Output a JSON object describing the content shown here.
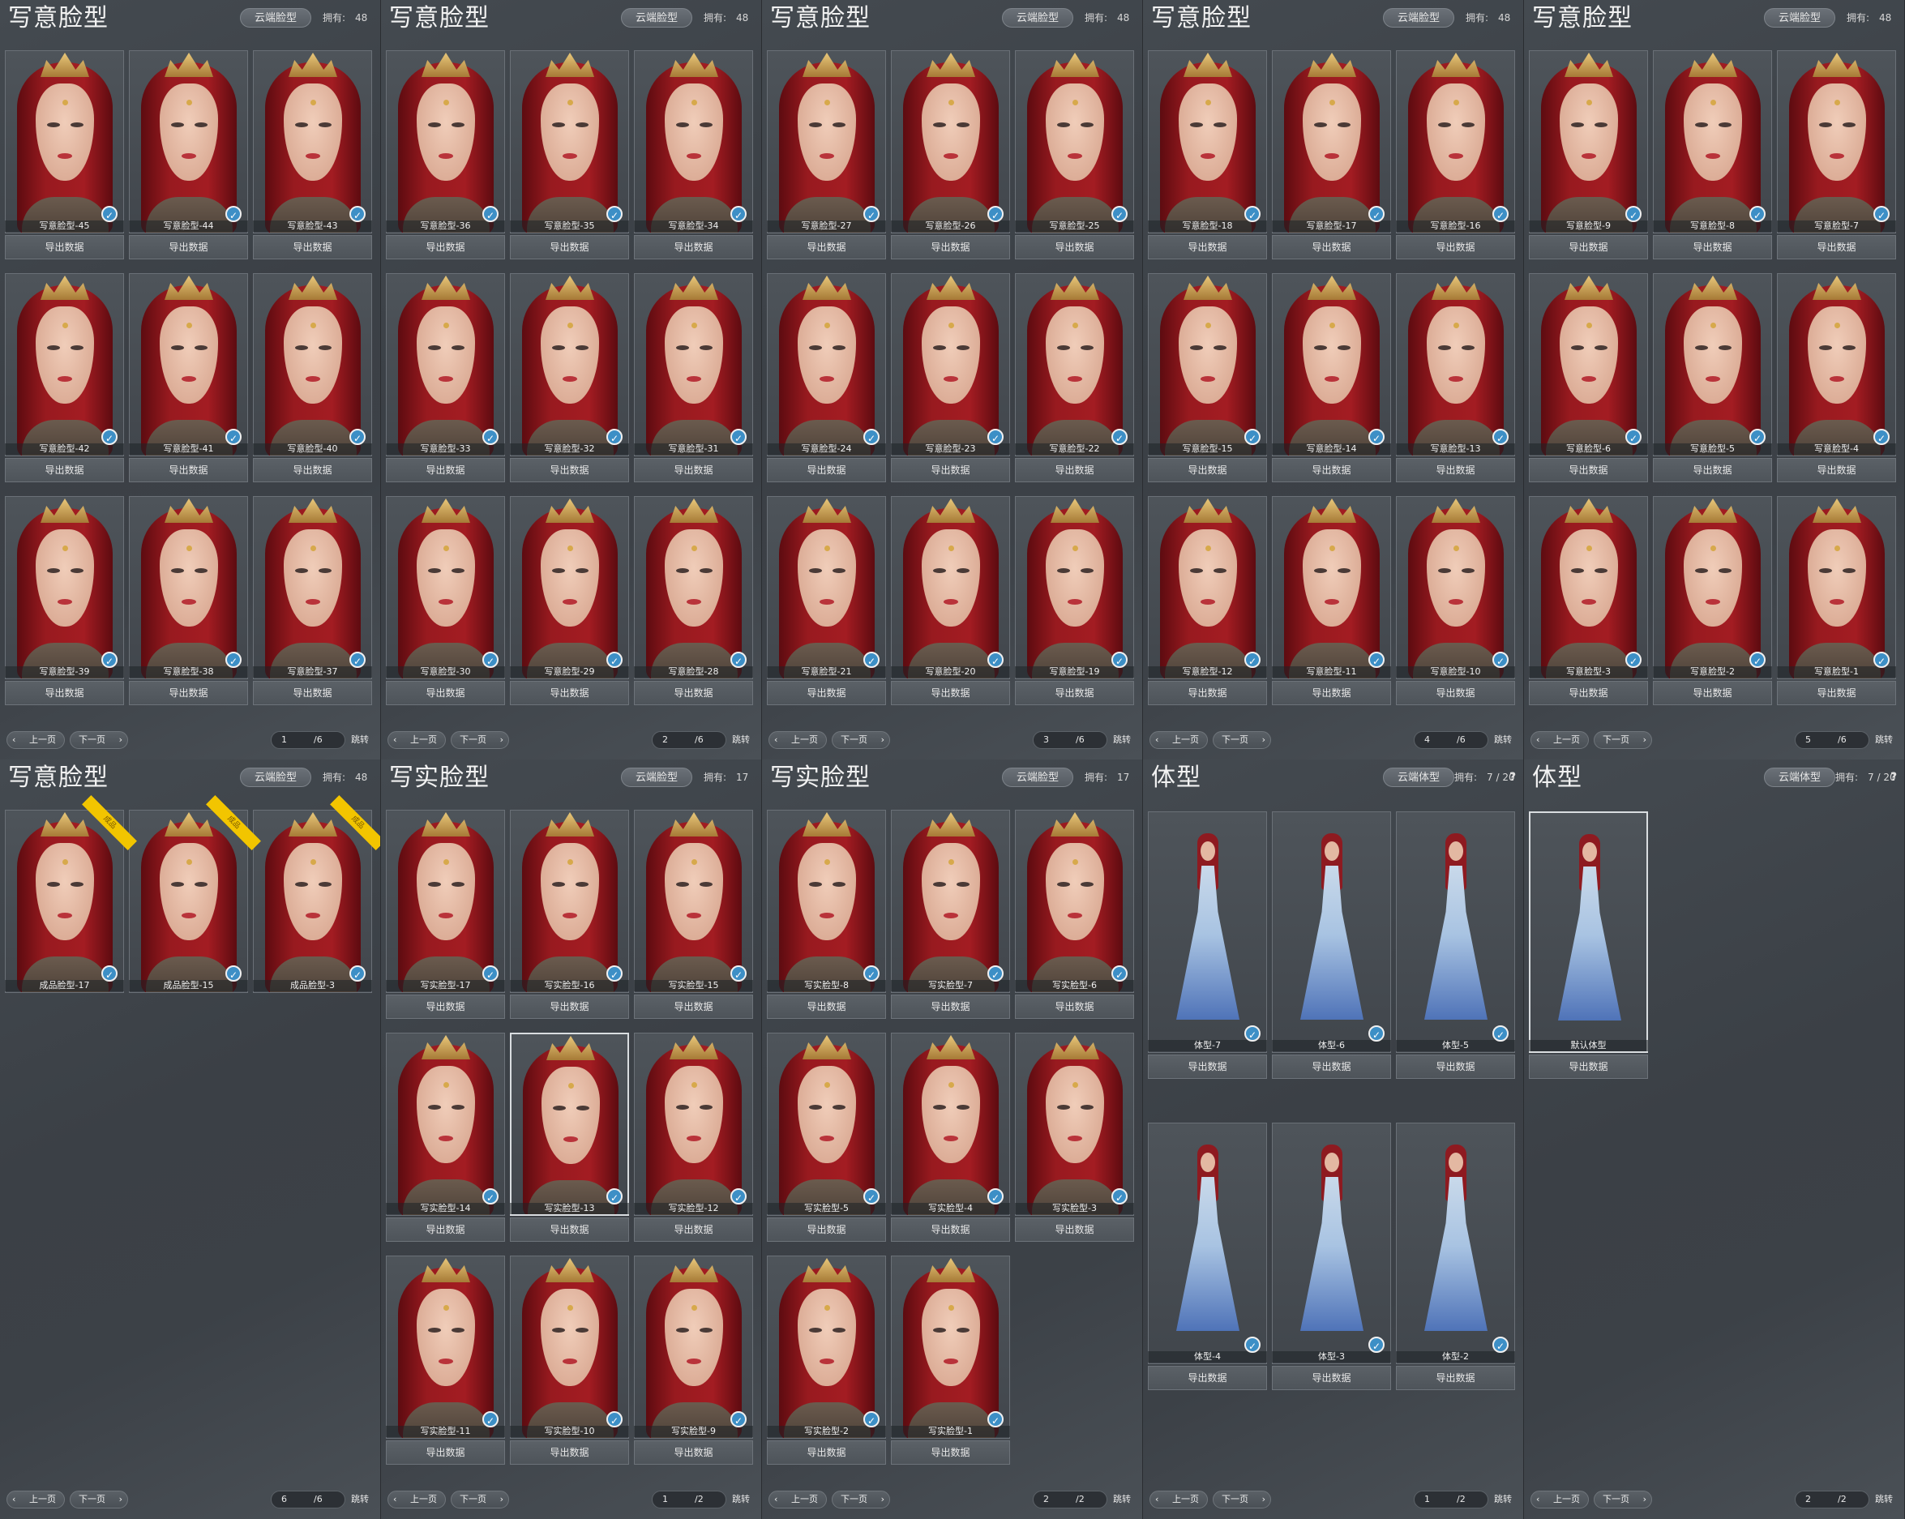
{
  "panels": [
    {
      "title": "写意脸型",
      "cloud": "云端脸型",
      "own_label": "拥有:",
      "own_value": "48",
      "has_help": false,
      "cards": [
        {
          "label": "写意脸型-45",
          "kind": "face",
          "btn": "导出数据"
        },
        {
          "label": "写意脸型-44",
          "kind": "face",
          "btn": "导出数据"
        },
        {
          "label": "写意脸型-43",
          "kind": "face",
          "btn": "导出数据"
        },
        {
          "label": "写意脸型-42",
          "kind": "face",
          "btn": "导出数据"
        },
        {
          "label": "写意脸型-41",
          "kind": "face",
          "btn": "导出数据"
        },
        {
          "label": "写意脸型-40",
          "kind": "face",
          "btn": "导出数据"
        },
        {
          "label": "写意脸型-39",
          "kind": "face",
          "btn": "导出数据"
        },
        {
          "label": "写意脸型-38",
          "kind": "face",
          "btn": "导出数据"
        },
        {
          "label": "写意脸型-37",
          "kind": "face",
          "btn": "导出数据"
        }
      ],
      "pager": {
        "prev": "上一页",
        "next": "下一页",
        "current": "1",
        "total": "/6",
        "go": "跳转"
      }
    },
    {
      "title": "写意脸型",
      "cloud": "云端脸型",
      "own_label": "拥有:",
      "own_value": "48",
      "has_help": false,
      "cards": [
        {
          "label": "写意脸型-36",
          "kind": "face",
          "btn": "导出数据"
        },
        {
          "label": "写意脸型-35",
          "kind": "face",
          "btn": "导出数据"
        },
        {
          "label": "写意脸型-34",
          "kind": "face",
          "btn": "导出数据"
        },
        {
          "label": "写意脸型-33",
          "kind": "face",
          "btn": "导出数据"
        },
        {
          "label": "写意脸型-32",
          "kind": "face",
          "btn": "导出数据"
        },
        {
          "label": "写意脸型-31",
          "kind": "face",
          "btn": "导出数据"
        },
        {
          "label": "写意脸型-30",
          "kind": "face",
          "btn": "导出数据"
        },
        {
          "label": "写意脸型-29",
          "kind": "face",
          "btn": "导出数据"
        },
        {
          "label": "写意脸型-28",
          "kind": "face",
          "btn": "导出数据"
        }
      ],
      "pager": {
        "prev": "上一页",
        "next": "下一页",
        "current": "2",
        "total": "/6",
        "go": "跳转"
      }
    },
    {
      "title": "写意脸型",
      "cloud": "云端脸型",
      "own_label": "拥有:",
      "own_value": "48",
      "has_help": false,
      "cards": [
        {
          "label": "写意脸型-27",
          "kind": "face",
          "btn": "导出数据"
        },
        {
          "label": "写意脸型-26",
          "kind": "face",
          "btn": "导出数据"
        },
        {
          "label": "写意脸型-25",
          "kind": "face",
          "btn": "导出数据"
        },
        {
          "label": "写意脸型-24",
          "kind": "face",
          "btn": "导出数据"
        },
        {
          "label": "写意脸型-23",
          "kind": "face",
          "btn": "导出数据"
        },
        {
          "label": "写意脸型-22",
          "kind": "face",
          "btn": "导出数据"
        },
        {
          "label": "写意脸型-21",
          "kind": "face",
          "btn": "导出数据"
        },
        {
          "label": "写意脸型-20",
          "kind": "face",
          "btn": "导出数据"
        },
        {
          "label": "写意脸型-19",
          "kind": "face",
          "btn": "导出数据"
        }
      ],
      "pager": {
        "prev": "上一页",
        "next": "下一页",
        "current": "3",
        "total": "/6",
        "go": "跳转"
      }
    },
    {
      "title": "写意脸型",
      "cloud": "云端脸型",
      "own_label": "拥有:",
      "own_value": "48",
      "has_help": false,
      "cards": [
        {
          "label": "写意脸型-18",
          "kind": "face",
          "btn": "导出数据"
        },
        {
          "label": "写意脸型-17",
          "kind": "face",
          "btn": "导出数据"
        },
        {
          "label": "写意脸型-16",
          "kind": "face",
          "btn": "导出数据"
        },
        {
          "label": "写意脸型-15",
          "kind": "face",
          "btn": "导出数据"
        },
        {
          "label": "写意脸型-14",
          "kind": "face",
          "btn": "导出数据"
        },
        {
          "label": "写意脸型-13",
          "kind": "face",
          "btn": "导出数据"
        },
        {
          "label": "写意脸型-12",
          "kind": "face",
          "btn": "导出数据"
        },
        {
          "label": "写意脸型-11",
          "kind": "face",
          "btn": "导出数据"
        },
        {
          "label": "写意脸型-10",
          "kind": "face",
          "btn": "导出数据"
        }
      ],
      "pager": {
        "prev": "上一页",
        "next": "下一页",
        "current": "4",
        "total": "/6",
        "go": "跳转"
      }
    },
    {
      "title": "写意脸型",
      "cloud": "云端脸型",
      "own_label": "拥有:",
      "own_value": "48",
      "has_help": false,
      "cards": [
        {
          "label": "写意脸型-9",
          "kind": "face",
          "btn": "导出数据"
        },
        {
          "label": "写意脸型-8",
          "kind": "face",
          "btn": "导出数据"
        },
        {
          "label": "写意脸型-7",
          "kind": "face",
          "btn": "导出数据"
        },
        {
          "label": "写意脸型-6",
          "kind": "face",
          "btn": "导出数据"
        },
        {
          "label": "写意脸型-5",
          "kind": "face",
          "btn": "导出数据"
        },
        {
          "label": "写意脸型-4",
          "kind": "face",
          "btn": "导出数据"
        },
        {
          "label": "写意脸型-3",
          "kind": "face",
          "btn": "导出数据"
        },
        {
          "label": "写意脸型-2",
          "kind": "face",
          "btn": "导出数据"
        },
        {
          "label": "写意脸型-1",
          "kind": "face",
          "btn": "导出数据"
        }
      ],
      "pager": {
        "prev": "上一页",
        "next": "下一页",
        "current": "5",
        "total": "/6",
        "go": "跳转"
      }
    },
    {
      "title": "写意脸型",
      "cloud": "云端脸型",
      "own_label": "拥有:",
      "own_value": "48",
      "has_help": false,
      "cards": [
        {
          "label": "成品脸型-17",
          "kind": "face",
          "ribbon": "成品"
        },
        {
          "label": "成品脸型-15",
          "kind": "face",
          "ribbon": "成品"
        },
        {
          "label": "成品脸型-3",
          "kind": "face",
          "ribbon": "成品"
        }
      ],
      "pager": {
        "prev": "上一页",
        "next": "下一页",
        "current": "6",
        "total": "/6",
        "go": "跳转"
      }
    },
    {
      "title": "写实脸型",
      "cloud": "云端脸型",
      "own_label": "拥有:",
      "own_value": "17",
      "has_help": false,
      "cards": [
        {
          "label": "写实脸型-17",
          "kind": "face",
          "btn": "导出数据"
        },
        {
          "label": "写实脸型-16",
          "kind": "face",
          "btn": "导出数据"
        },
        {
          "label": "写实脸型-15",
          "kind": "face",
          "btn": "导出数据"
        },
        {
          "label": "写实脸型-14",
          "kind": "face",
          "btn": "导出数据"
        },
        {
          "label": "写实脸型-13",
          "kind": "face",
          "btn": "导出数据",
          "selected": true
        },
        {
          "label": "写实脸型-12",
          "kind": "face",
          "btn": "导出数据"
        },
        {
          "label": "写实脸型-11",
          "kind": "face",
          "btn": "导出数据"
        },
        {
          "label": "写实脸型-10",
          "kind": "face",
          "btn": "导出数据"
        },
        {
          "label": "写实脸型-9",
          "kind": "face",
          "btn": "导出数据"
        }
      ],
      "pager": {
        "prev": "上一页",
        "next": "下一页",
        "current": "1",
        "total": "/2",
        "go": "跳转"
      }
    },
    {
      "title": "写实脸型",
      "cloud": "云端脸型",
      "own_label": "拥有:",
      "own_value": "17",
      "has_help": false,
      "cards": [
        {
          "label": "写实脸型-8",
          "kind": "face",
          "btn": "导出数据"
        },
        {
          "label": "写实脸型-7",
          "kind": "face",
          "btn": "导出数据"
        },
        {
          "label": "写实脸型-6",
          "kind": "face",
          "btn": "导出数据"
        },
        {
          "label": "写实脸型-5",
          "kind": "face",
          "btn": "导出数据"
        },
        {
          "label": "写实脸型-4",
          "kind": "face",
          "btn": "导出数据"
        },
        {
          "label": "写实脸型-3",
          "kind": "face",
          "btn": "导出数据"
        },
        {
          "label": "写实脸型-2",
          "kind": "face",
          "btn": "导出数据"
        },
        {
          "label": "写实脸型-1",
          "kind": "face",
          "btn": "导出数据"
        }
      ],
      "pager": {
        "prev": "上一页",
        "next": "下一页",
        "current": "2",
        "total": "/2",
        "go": "跳转"
      }
    },
    {
      "title": "体型",
      "cloud": "云端体型",
      "own_label": "拥有:",
      "own_value": "7 / 20",
      "has_help": true,
      "help": "?",
      "cards": [
        {
          "label": "体型-7",
          "kind": "body",
          "btn": "导出数据"
        },
        {
          "label": "体型-6",
          "kind": "body",
          "btn": "导出数据"
        },
        {
          "label": "体型-5",
          "kind": "body",
          "btn": "导出数据"
        },
        {
          "label": "体型-4",
          "kind": "body",
          "btn": "导出数据"
        },
        {
          "label": "体型-3",
          "kind": "body",
          "btn": "导出数据"
        },
        {
          "label": "体型-2",
          "kind": "body",
          "btn": "导出数据"
        }
      ],
      "pager": {
        "prev": "上一页",
        "next": "下一页",
        "current": "1",
        "total": "/2",
        "go": "跳转"
      }
    },
    {
      "title": "体型",
      "cloud": "云端体型",
      "own_label": "拥有:",
      "own_value": "7 / 20",
      "has_help": true,
      "help": "?",
      "cards": [
        {
          "label": "默认体型",
          "kind": "body",
          "btn": "导出数据",
          "selected": true,
          "no_badge": true
        }
      ],
      "pager": {
        "prev": "上一页",
        "next": "下一页",
        "current": "2",
        "total": "/2",
        "go": "跳转"
      }
    }
  ],
  "icons": {
    "badge": "brush-check-icon",
    "prev_arrow": "‹",
    "next_arrow": "›"
  },
  "colors": {
    "panel_bg": "#3e4349",
    "hair": "#a31c22",
    "badge": "#3d8fc6",
    "ribbon": "#f2c500"
  }
}
